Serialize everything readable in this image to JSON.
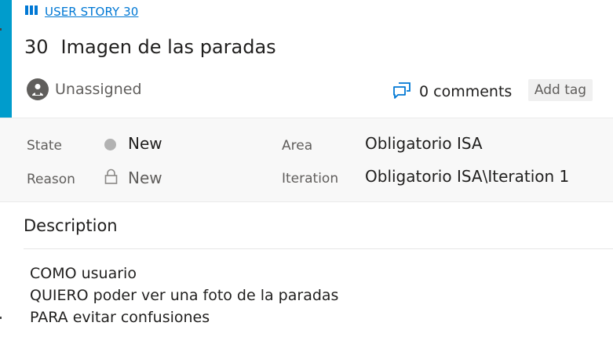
{
  "work_item": {
    "type_label": "USER STORY 30",
    "id": "30",
    "title": "Imagen de las paradas",
    "assignee": "Unassigned",
    "comments": "0 comments",
    "add_tag": "Add tag"
  },
  "fields": {
    "state": {
      "label": "State",
      "value": "New",
      "color": "#b2b2b2"
    },
    "reason": {
      "label": "Reason",
      "value": "New"
    },
    "area": {
      "label": "Area",
      "value": "Obligatorio ISA"
    },
    "iteration": {
      "label": "Iteration",
      "value": "Obligatorio ISA\\Iteration 1"
    }
  },
  "description": {
    "heading": "Description",
    "lines": [
      "COMO usuario",
      "QUIERO poder ver una foto de la paradas",
      "PARA evitar confusiones"
    ]
  },
  "colors": {
    "accent": "#009ccc",
    "link": "#0078d4"
  },
  "icons": {
    "type": "book-icon",
    "assignee": "unassigned-avatar-icon",
    "comments": "comments-icon",
    "reason": "lock-icon"
  }
}
